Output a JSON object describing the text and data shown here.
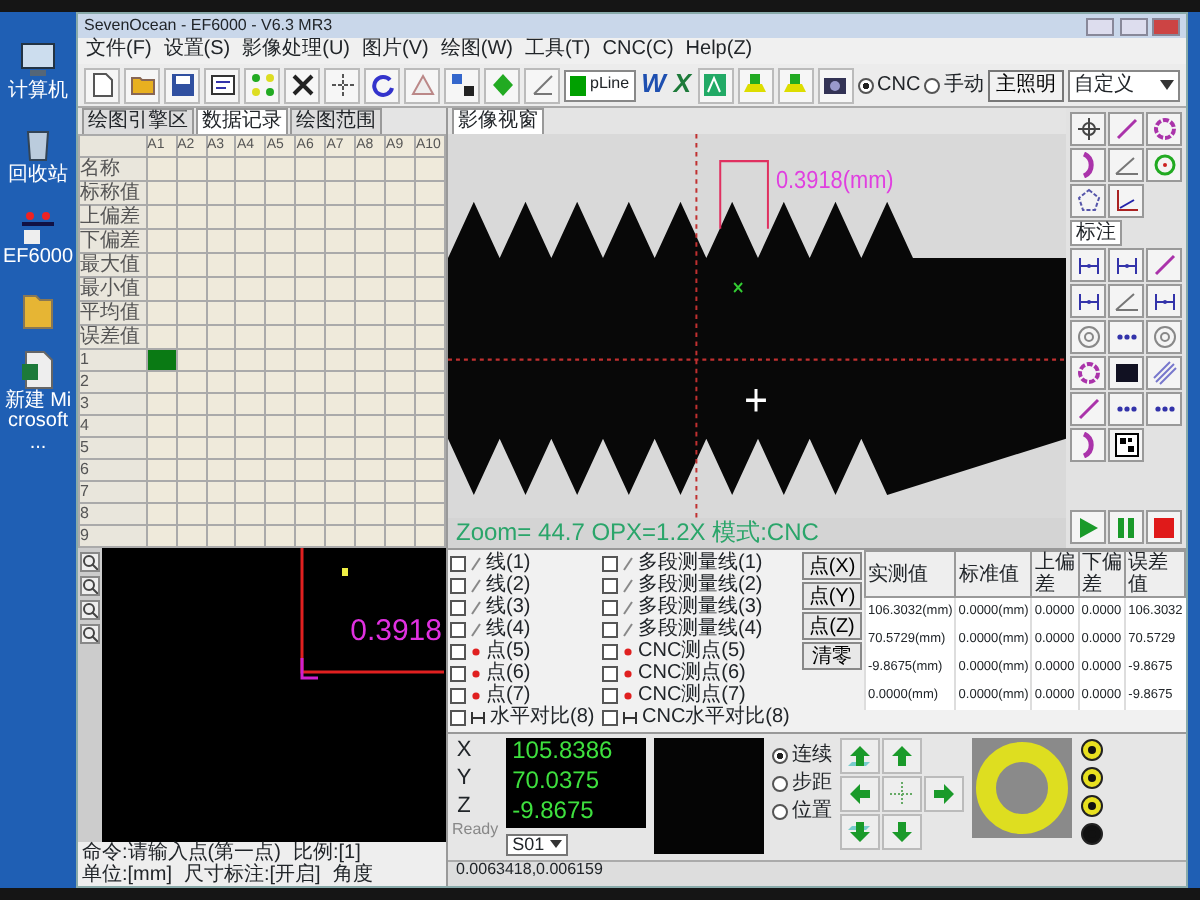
{
  "desktop_icons": [
    {
      "kind": "computer",
      "label": "计算机"
    },
    {
      "kind": "recycle",
      "label": "回收站"
    },
    {
      "kind": "app",
      "label": "EF6000"
    },
    {
      "kind": "folder"
    },
    {
      "kind": "spreadsheet",
      "label": "新建 Microsoft ..."
    }
  ],
  "window": {
    "title": "SevenOcean - EF6000 - V6.3 MR3"
  },
  "menu": [
    "文件(F)",
    "设置(S)",
    "影像处理(U)",
    "图片(V)",
    "绘图(W)",
    "工具(T)",
    "CNC(C)",
    "Help(Z)"
  ],
  "toolbar": {
    "line_style": "pLine",
    "export": [
      "W",
      "X"
    ],
    "mode_options": [
      {
        "label": "CNC",
        "selected": true
      },
      {
        "label": "手动",
        "selected": false
      }
    ],
    "light_button": "主照明",
    "profile": "自定义"
  },
  "data_tabs": [
    {
      "label": "绘图引擎区",
      "selected": false
    },
    {
      "label": "数据记录",
      "selected": true
    },
    {
      "label": "绘图范围",
      "selected": false
    }
  ],
  "grid": {
    "columns": [
      "A1",
      "A2",
      "A3",
      "A4",
      "A5",
      "A6",
      "A7",
      "A8",
      "A9",
      "A10"
    ],
    "stat_rows": [
      "名称",
      "标称值",
      "上偏差",
      "下偏差",
      "最大值",
      "最小值",
      "平均值",
      "误差值"
    ],
    "rows": [
      {
        "label": "1",
        "selected": true
      },
      {
        "label": "2",
        "selected": false
      },
      {
        "label": "3",
        "selected": false
      },
      {
        "label": "4",
        "selected": false
      },
      {
        "label": "5",
        "selected": false
      },
      {
        "label": "6",
        "selected": false
      },
      {
        "label": "7",
        "selected": false
      },
      {
        "label": "8",
        "selected": false
      },
      {
        "label": "9",
        "selected": false
      }
    ]
  },
  "drawing_canvas": {
    "reading": "0.3918",
    "status": [
      "命令:请输入点(第一点)",
      "比例:[1]",
      "单位:[mm]",
      "尺寸标注:[开启]",
      "角度"
    ]
  },
  "video": {
    "tab": "影像视窗",
    "measurement": "0.3918(mm)",
    "info": "Zoom= 44.7 OPX=1.2X 模式:CNC"
  },
  "tool_palette": {
    "tab": "标注"
  },
  "line_list": [
    {
      "kind": "line",
      "label": "线(1)",
      "checked": false
    },
    {
      "kind": "line",
      "label": "线(2)",
      "checked": false
    },
    {
      "kind": "line",
      "label": "线(3)",
      "checked": false
    },
    {
      "kind": "line",
      "label": "线(4)",
      "checked": false
    },
    {
      "kind": "point",
      "label": "点(5)",
      "checked": false
    },
    {
      "kind": "point",
      "label": "点(6)",
      "checked": false
    },
    {
      "kind": "point",
      "label": "点(7)",
      "checked": false
    },
    {
      "kind": "span",
      "label": "水平对比(8)",
      "checked": false
    }
  ],
  "cnc_list": [
    {
      "kind": "line",
      "label": "多段测量线(1)",
      "checked": false
    },
    {
      "kind": "line",
      "label": "多段测量线(2)",
      "checked": false
    },
    {
      "kind": "line",
      "label": "多段测量线(3)",
      "checked": false
    },
    {
      "kind": "line",
      "label": "多段测量线(4)",
      "checked": false
    },
    {
      "kind": "point",
      "label": "CNC测点(5)",
      "checked": false
    },
    {
      "kind": "point",
      "label": "CNC测点(6)",
      "checked": false
    },
    {
      "kind": "point",
      "label": "CNC测点(7)",
      "checked": false
    },
    {
      "kind": "span",
      "label": "CNC水平对比(8)",
      "checked": false
    }
  ],
  "point_buttons": [
    "点(X)",
    "点(Y)",
    "点(Z)",
    "清零"
  ],
  "results": {
    "columns": [
      "实测值",
      "标准值",
      "上偏差",
      "下偏差",
      "误差值"
    ],
    "rows": [
      [
        "106.3032(mm)",
        "0.0000(mm)",
        "0.0000",
        "0.0000",
        "106.3032"
      ],
      [
        "70.5729(mm)",
        "0.0000(mm)",
        "0.0000",
        "0.0000",
        "70.5729"
      ],
      [
        "-9.8675(mm)",
        "0.0000(mm)",
        "0.0000",
        "0.0000",
        "-9.8675"
      ],
      [
        "0.0000(mm)",
        "0.0000(mm)",
        "0.0000",
        "0.0000",
        "-9.8675"
      ]
    ]
  },
  "dro": [
    {
      "axis": "X",
      "value": "105.8386"
    },
    {
      "axis": "Y",
      "value": "70.0375"
    },
    {
      "axis": "Z",
      "value": "-9.8675"
    }
  ],
  "dro_state": "Ready",
  "station": "S01",
  "move_modes": [
    {
      "label": "连续",
      "selected": true
    },
    {
      "label": "步距",
      "selected": false
    },
    {
      "label": "位置",
      "selected": false
    }
  ],
  "status_bar": [
    "0.0063418,0.006159"
  ]
}
